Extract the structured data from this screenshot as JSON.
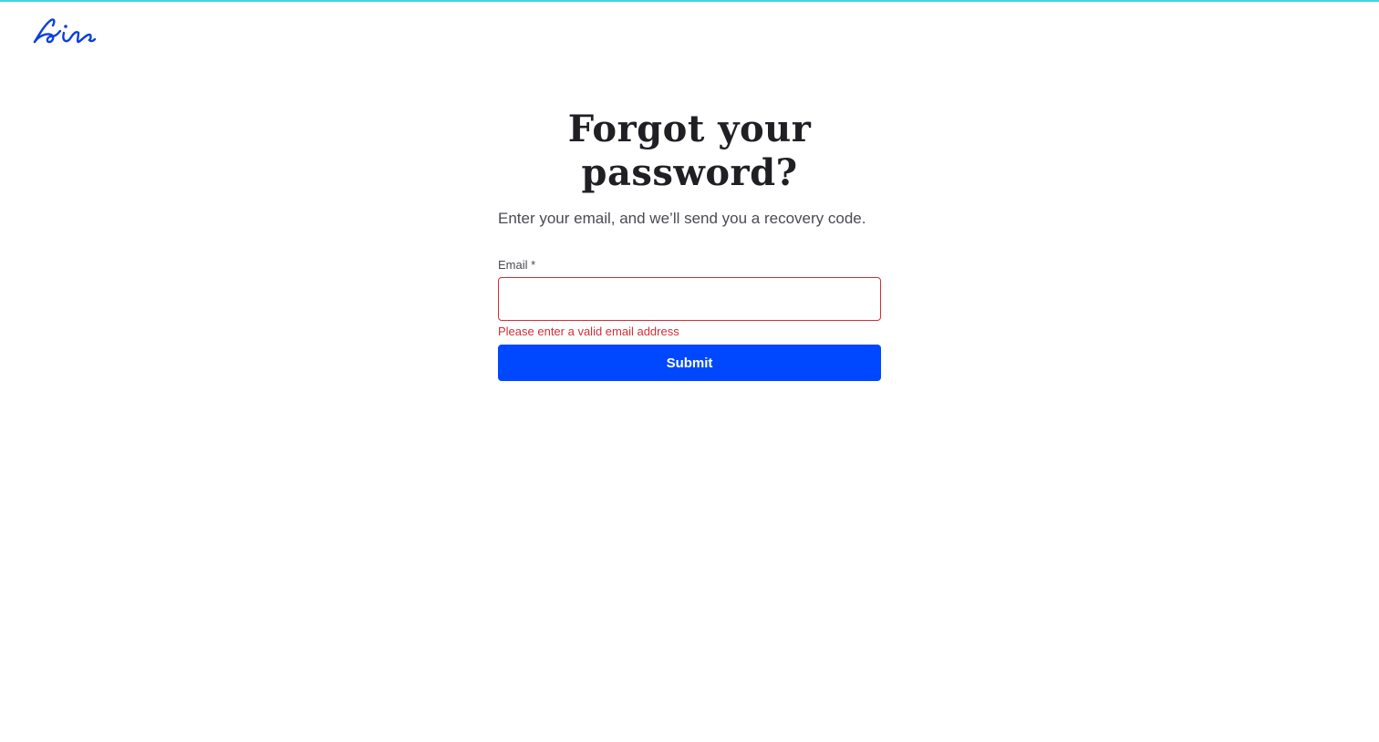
{
  "logo": {
    "icon": "air-logo-icon",
    "color": "#0a3fe0"
  },
  "header": {
    "accent_color": "#3fd6e0"
  },
  "form": {
    "title": "Forgot your password?",
    "subtitle": "Enter your email, and we’ll send you a recovery code.",
    "email_label": "Email *",
    "email_value": "",
    "email_placeholder": "",
    "error_message": "Please enter a valid email address",
    "submit_label": "Submit",
    "error_color": "#cf2f3a",
    "button_color": "#0048ff"
  }
}
